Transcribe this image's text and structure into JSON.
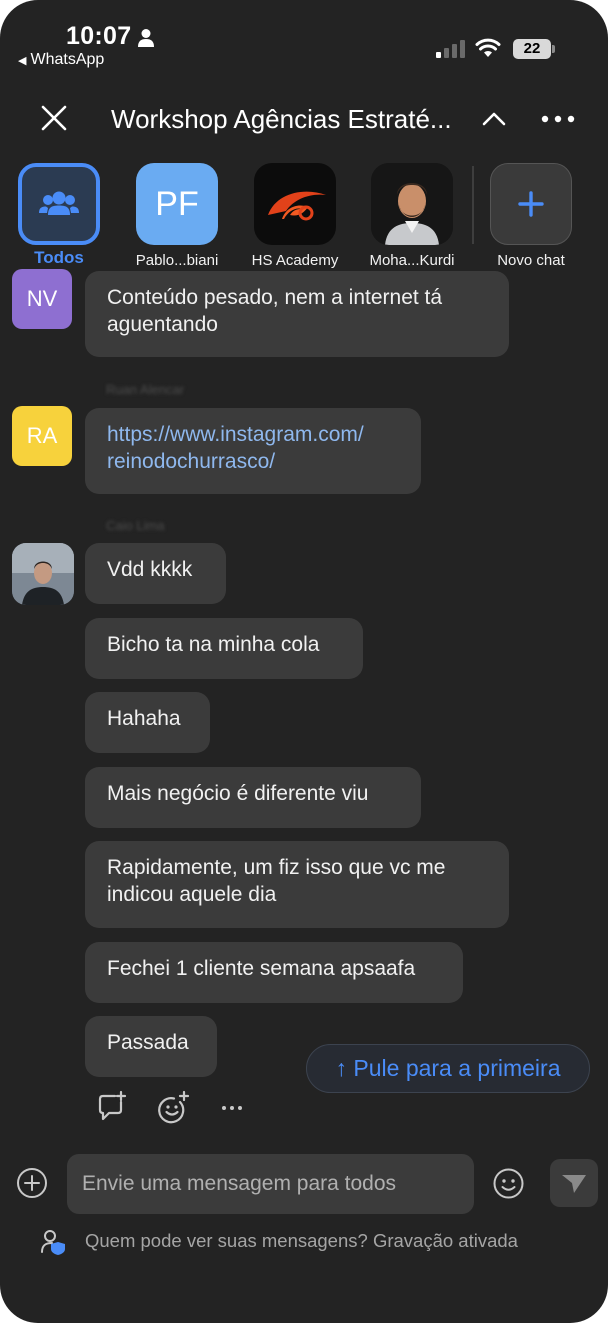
{
  "status_bar": {
    "time": "10:07",
    "back_app": "WhatsApp",
    "battery": "22"
  },
  "header": {
    "title": "Workshop Agências Estraté..."
  },
  "chat_strip": [
    {
      "label": "Todos",
      "initials": ""
    },
    {
      "label": "Pablo...biani",
      "initials": "PF"
    },
    {
      "label": "HS Academy",
      "initials": ""
    },
    {
      "label": "Moha...Kurdi",
      "initials": ""
    },
    {
      "label": "Novo chat",
      "initials": ""
    }
  ],
  "messages": [
    {
      "avatar_initials": "NV",
      "avatar_color": "#8e6fd1",
      "sender": "",
      "texts": [
        "Conteúdo pesado, nem a internet tá",
        "aguentando"
      ]
    },
    {
      "avatar_initials": "RA",
      "avatar_color": "#f7d23c",
      "sender": "Ruan Alencar",
      "texts": [
        "https://www.instagram.com/",
        "reinodochurrasco/"
      ]
    },
    {
      "avatar_initials": "",
      "sender": "Caio Lima",
      "texts": [
        "Vdd kkkk",
        "Bicho ta na minha cola",
        "Hahaha",
        "Mais negócio é diferente viu",
        "Rapidamente, um fiz isso que vc me",
        "indicou aquele dia",
        "Fechei 1 cliente semana apsaafa",
        "Passada"
      ]
    }
  ],
  "jump_button": "↑ Pule para a primeira",
  "composer": {
    "placeholder": "Envie uma mensagem para todos"
  },
  "footer": {
    "privacy_text": "Quem pode ver suas mensagens? Gravação ativada"
  },
  "colors": {
    "background": "#232323",
    "bubble": "#3b3b3b",
    "accent": "#4a8cf7",
    "link": "#8fb8ee"
  },
  "icons": [
    "person-icon",
    "signal-icon",
    "wifi-icon",
    "battery-icon",
    "close-icon",
    "chevron-up-icon",
    "more-icon",
    "group-icon",
    "plus-icon",
    "reply-icon",
    "add-reaction-icon",
    "more-actions-icon",
    "add-icon",
    "emoji-icon",
    "send-icon",
    "privacy-icon"
  ]
}
